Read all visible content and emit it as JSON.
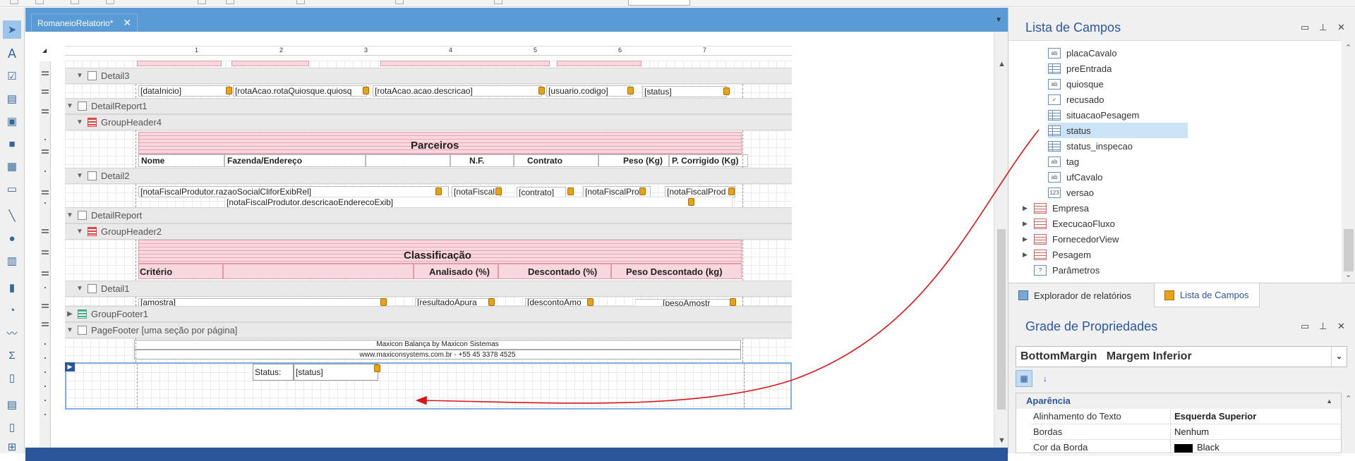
{
  "document_tab": {
    "title": "RomaneioRelatorio*",
    "close": "✕"
  },
  "ruler": {
    "marks": [
      "1",
      "2",
      "3",
      "4",
      "5",
      "6",
      "7"
    ]
  },
  "bands": {
    "detail3": "Detail3",
    "detail_report1": "DetailReport1",
    "group_header4": "GroupHeader4",
    "detail2": "Detail2",
    "detail_report": "DetailReport",
    "group_header2": "GroupHeader2",
    "detail1": "Detail1",
    "group_footer1": "GroupFooter1",
    "page_footer": "PageFooter [uma seção por página]"
  },
  "detail3_fields": [
    "[dataInicio]",
    "[rotaAcao.rotaQuiosque.quiosq",
    "[rotaAcao.acao.descricao]",
    "[usuario.codigo]",
    "[status]"
  ],
  "parceiros": {
    "title": "Parceiros",
    "headers": [
      "Nome",
      "Fazenda/Endereço",
      "N.F.",
      "Contrato",
      "Peso (Kg)",
      "P. Corrigido (Kg)"
    ]
  },
  "detail2_fields": [
    "[notaFiscalProdutor.razaoSocialCliforExibRel]",
    "[notaFiscal",
    "[contrato]",
    "[notaFiscalPro",
    "[notaFiscalProd",
    "[notaFiscalProdutor.descricaoEnderecoExib]"
  ],
  "classificacao": {
    "title": "Classificação",
    "headers": [
      "Critério",
      "Analisado (%)",
      "Descontado (%)",
      "Peso Descontado (kg)"
    ]
  },
  "detail1_fields": [
    "[amostra]",
    "[resultadoApura",
    "[descontoAmo",
    "[pesoAmostr"
  ],
  "page_footer": {
    "line1": "Maxicon Balança by Maxicon Sistemas",
    "line2": "www.maxiconsystems.com.br - +55 45 3378 4525",
    "status_label": "Status:",
    "status_field": "[status]"
  },
  "fields_panel": {
    "title": "Lista de Campos",
    "items": [
      {
        "label": "placaCavalo",
        "icon": "ab-icon"
      },
      {
        "label": "preEntrada",
        "icon": "grid-icon"
      },
      {
        "label": "quiosque",
        "icon": "ab-icon"
      },
      {
        "label": "recusado",
        "icon": "check-icon"
      },
      {
        "label": "situacaoPesagem",
        "icon": "grid-icon"
      },
      {
        "label": "status",
        "icon": "grid-icon",
        "selected": true
      },
      {
        "label": "status_inspecao",
        "icon": "grid-icon"
      },
      {
        "label": "tag",
        "icon": "ab-icon"
      },
      {
        "label": "ufCavalo",
        "icon": "ab-icon"
      },
      {
        "label": "versao",
        "icon": "number-icon"
      }
    ],
    "groups": [
      "Empresa",
      "ExecucaoFluxo",
      "FornecedorView",
      "Pesagem"
    ],
    "params": "Parâmetros"
  },
  "bottom_tabs": {
    "explorer": "Explorador de relatórios",
    "fields": "Lista de Campos"
  },
  "props_panel": {
    "title": "Grade de Propriedades",
    "selected_object": "BottomMargin   Margem Inferior",
    "category": "Aparência",
    "rows": [
      {
        "key": "Alinhamento do Texto",
        "value": "Esquerda Superior",
        "bold": true
      },
      {
        "key": "Bordas",
        "value": "Nenhum"
      },
      {
        "key": "Cor da Borda",
        "value": "Black"
      }
    ]
  },
  "icons": {
    "ab": "ab",
    "number": "123",
    "check": "✓",
    "param": "?"
  },
  "colors": {
    "accent": "#2b579a",
    "tab_blue": "#5a9bd5",
    "band_pink": "#f8d7df",
    "arrow_red": "#d9141b"
  }
}
